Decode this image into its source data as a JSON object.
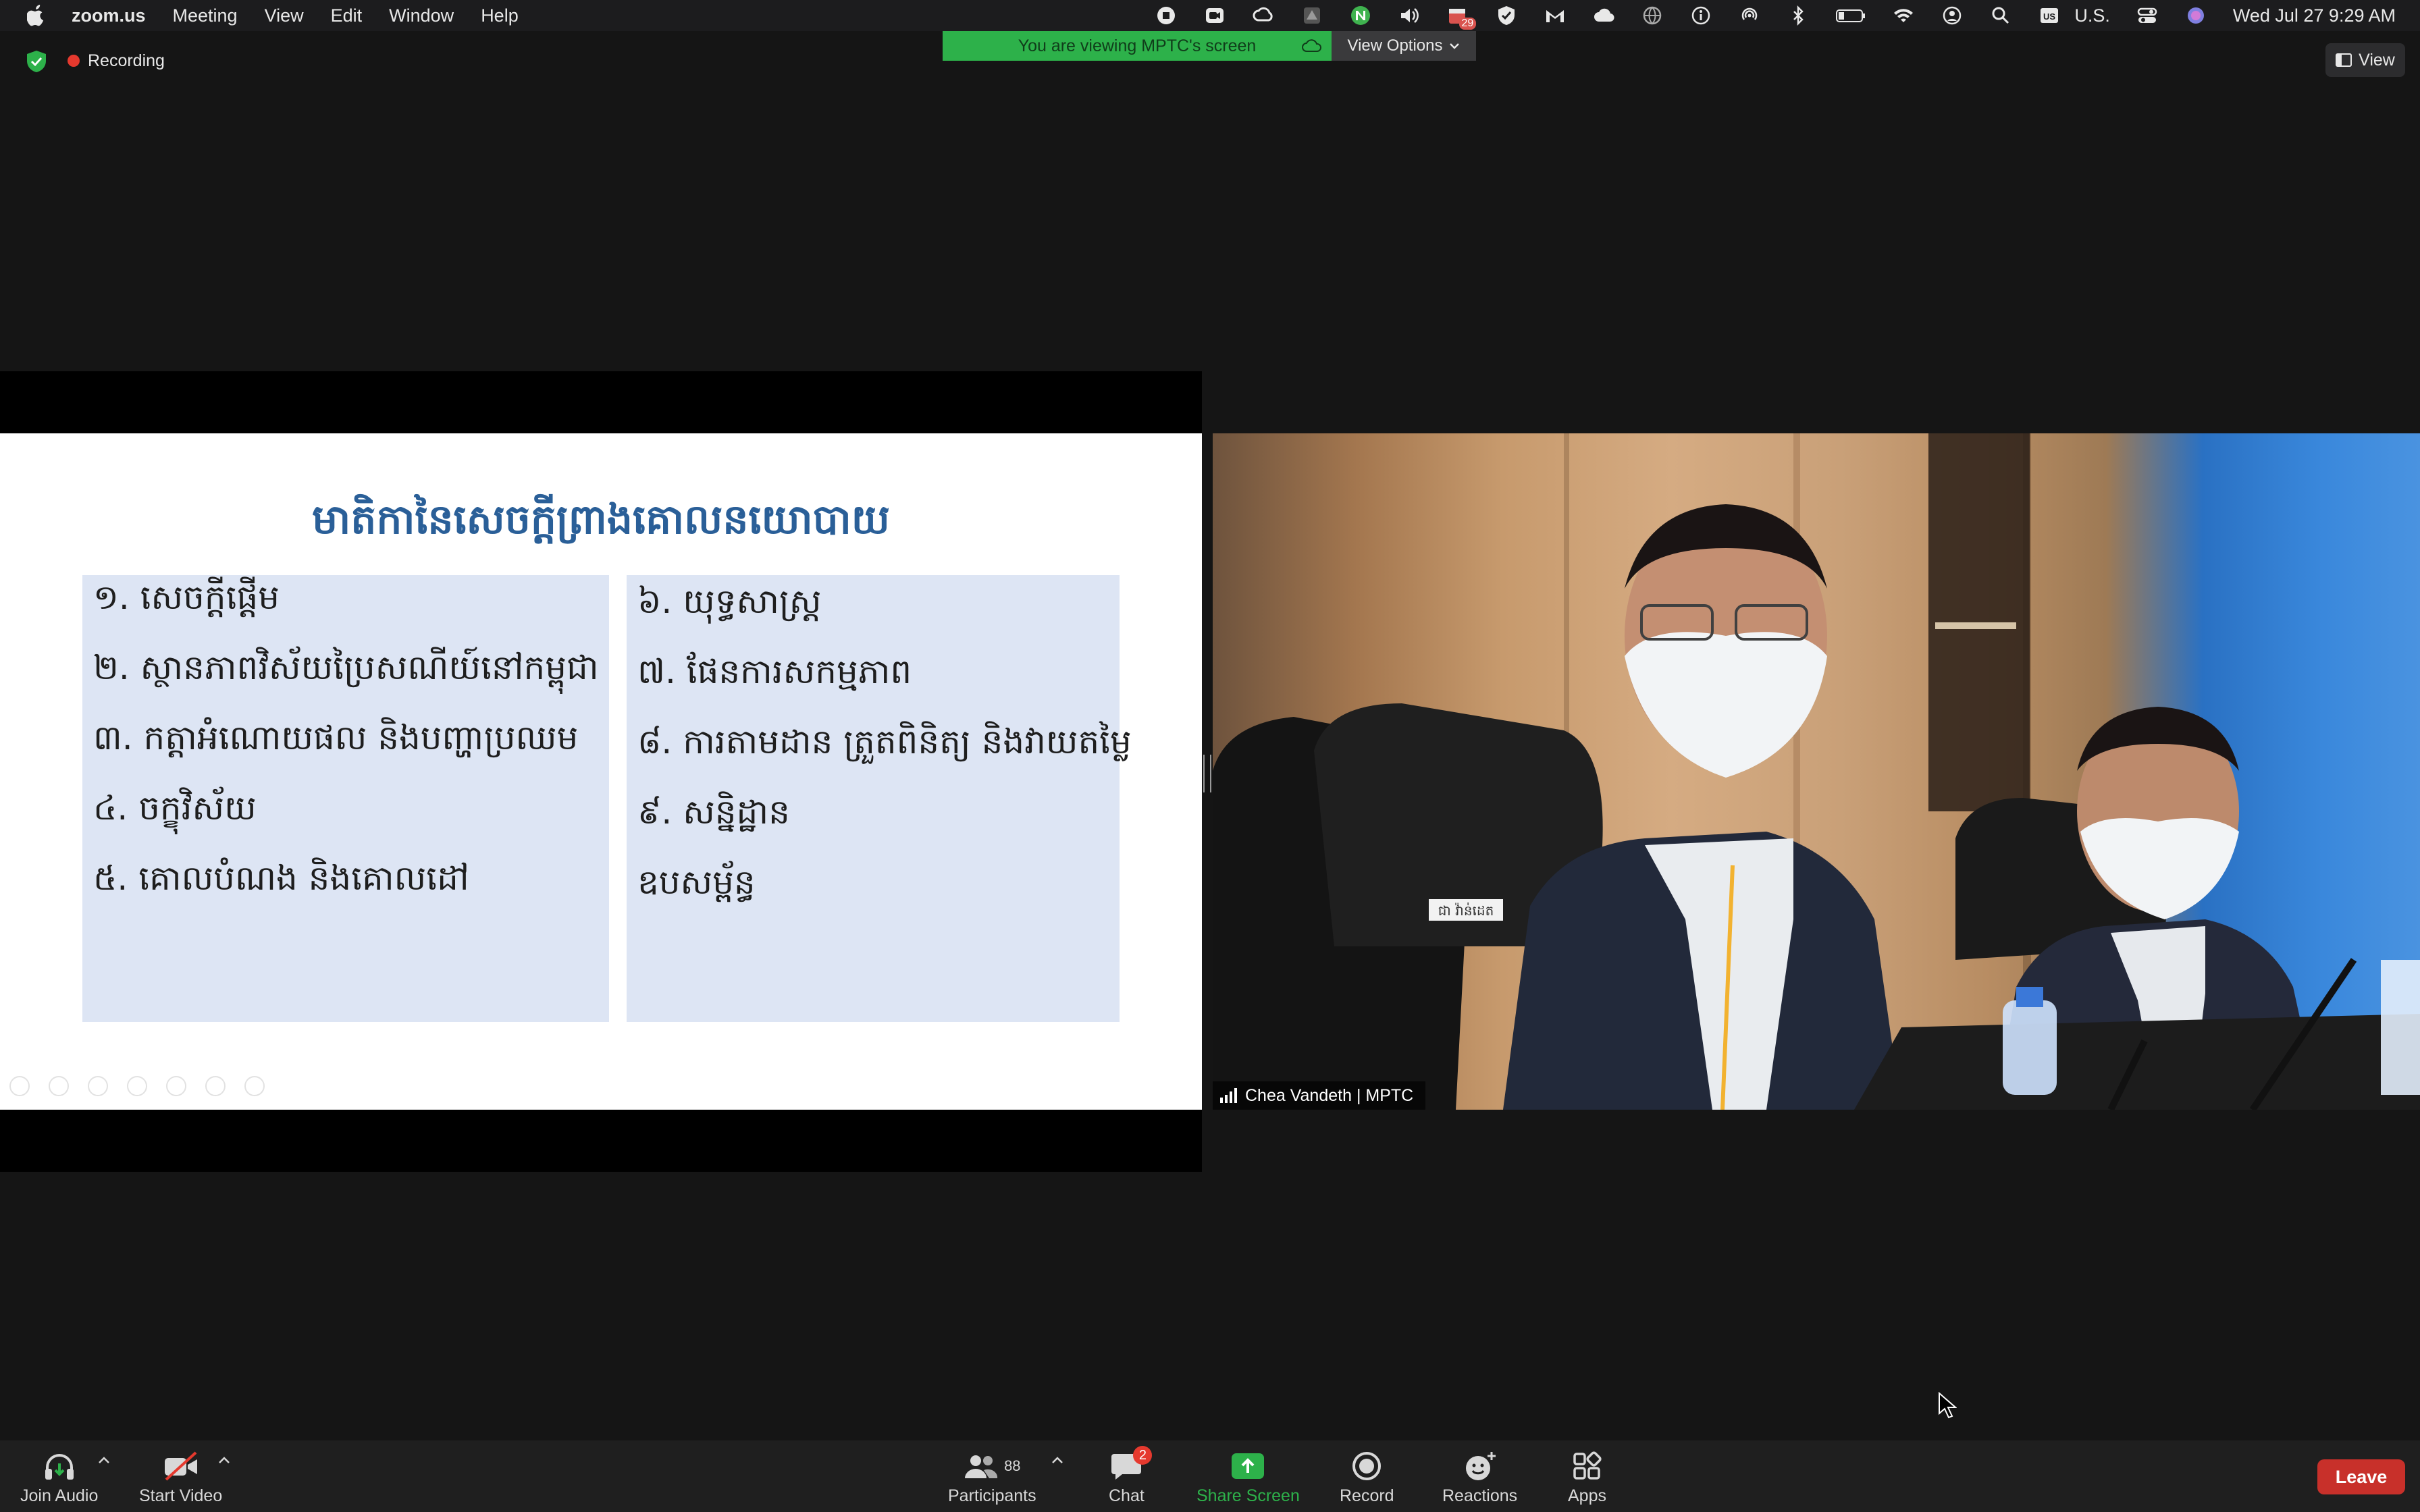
{
  "menubar": {
    "app_name": "zoom.us",
    "menus": [
      "Meeting",
      "View",
      "Edit",
      "Window",
      "Help"
    ],
    "input_source": "U.S.",
    "clock": "Wed Jul 27  9:29 AM",
    "tray_badge": "29",
    "tray_icons": [
      "screen-record-icon",
      "zoom-video-icon",
      "creative-cloud-icon",
      "drive-icon",
      "nordvpn-icon",
      "volume-icon",
      "calendar-badge-icon",
      "shield-check-icon",
      "gmail-icon",
      "cloud-icon",
      "globe-icon",
      "info-icon",
      "airdrop-icon",
      "bluetooth-icon",
      "battery-icon",
      "wifi-icon",
      "user-icon",
      "search-icon",
      "flag-icon",
      "control-center-icon",
      "siri-icon"
    ]
  },
  "meeting": {
    "recording_label": "Recording",
    "viewing_banner": "You are viewing MPTC's screen",
    "view_options_label": "View Options",
    "view_button_label": "View"
  },
  "slide": {
    "title": "មាតិកានៃសេចក្តីព្រាងគោលនយោបាយ",
    "left_items": [
      "១. សេចក្តីផ្តើម",
      "២. ស្ថានភាពវិស័យប្រៃសណីយ៍នៅកម្ពុជា",
      "៣. កត្តាអំណោយផល និងបញ្ហាប្រឈម",
      "៤. ចក្ខុវិស័យ",
      "៥. គោលបំណង និងគោលដៅ"
    ],
    "right_items": [
      "៦. យុទ្ធសាស្ត្រ",
      "៧. ផែនការសកម្មភាព",
      "៨. ការតាមដាន ត្រួតពិនិត្យ និងវាយតម្លៃ",
      "៩. សន្និដ្ឋាន",
      "ឧបសម្ព័ន្ធ"
    ]
  },
  "video": {
    "participant_name": "Chea Vandeth | MPTC",
    "placard_text": "ជា វ៉ាន់ដេត"
  },
  "toolbar": {
    "join_audio": "Join Audio",
    "start_video": "Start Video",
    "participants": "Participants",
    "participants_count": "88",
    "chat": "Chat",
    "chat_badge": "2",
    "share_screen": "Share Screen",
    "record": "Record",
    "reactions": "Reactions",
    "apps": "Apps",
    "leave": "Leave"
  },
  "colors": {
    "share_green": "#2db14a",
    "leave_red": "#c8302a",
    "slide_title_blue": "#2a5f98",
    "slide_box": "#dde5f4"
  }
}
